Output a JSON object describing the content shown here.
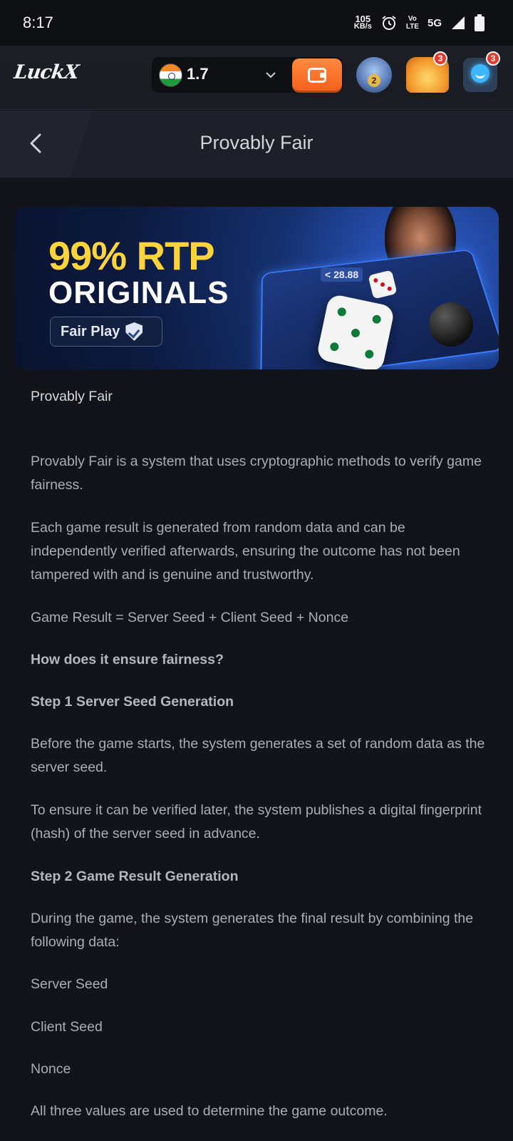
{
  "status_bar": {
    "time": "8:17",
    "net_speed_value": "105",
    "net_speed_unit": "KB/s",
    "volte_top": "Vo",
    "volte_bottom": "LTE",
    "network": "5G"
  },
  "header": {
    "logo": "LuckX",
    "balance": "1.7",
    "vip_level": "2",
    "chest_badge": "3",
    "support_badge": "3"
  },
  "title_bar": {
    "title": "Provably Fair"
  },
  "banner": {
    "headline": "99% RTP",
    "subheadline": "ORIGINALS",
    "chip_label": "Fair Play",
    "tablet_value": "< 28.88"
  },
  "article": {
    "intro": "Provably Fair",
    "paragraphs": [
      "Provably Fair is a system that uses cryptographic methods to verify game fairness.",
      "Each game result is generated from random data and can be independently verified afterwards, ensuring the outcome has not been tampered with and is genuine and trustworthy.",
      "Game Result = Server Seed + Client Seed + Nonce",
      "How does it ensure fairness?",
      "Step 1 Server Seed Generation",
      "Before the game starts, the system generates a set of random data as the server seed.",
      "To ensure it can be verified later, the system publishes a digital fingerprint (hash) of the server seed in advance.",
      "Step 2 Game Result Generation",
      "During the game, the system generates the final result by combining the following data:",
      "Server Seed",
      "Client Seed",
      "Nonce",
      "All three values are used to determine the game outcome."
    ]
  },
  "colors": {
    "background": "#131419",
    "header": "#1c1e26",
    "wallet_accent": "#f45f1b",
    "rtp_yellow": "#ffd43a",
    "badge_red": "#e23a2e"
  }
}
